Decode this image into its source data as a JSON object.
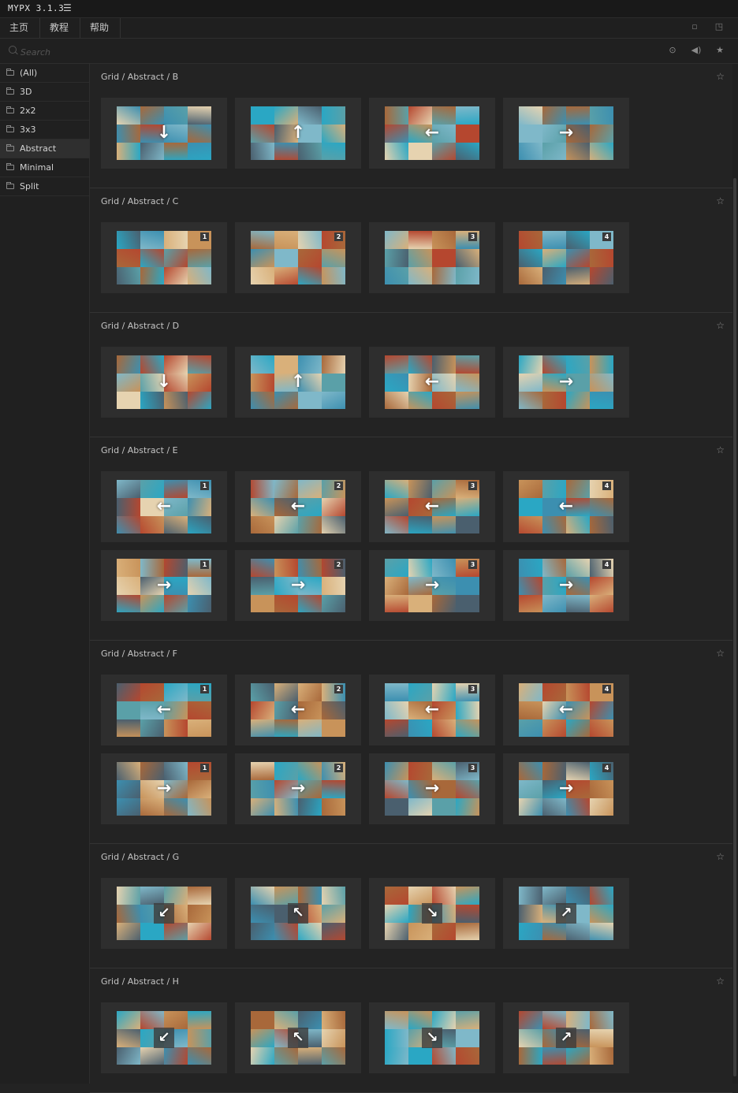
{
  "app": {
    "title": "MYPX 3.1.3"
  },
  "menu": {
    "items": [
      "主页",
      "教程",
      "帮助"
    ]
  },
  "search": {
    "placeholder": "Search"
  },
  "sidebar": {
    "items": [
      {
        "label": "(All)",
        "active": false
      },
      {
        "label": "3D",
        "active": false
      },
      {
        "label": "2x2",
        "active": false
      },
      {
        "label": "3x3",
        "active": false
      },
      {
        "label": "Abstract",
        "active": true
      },
      {
        "label": "Minimal",
        "active": false
      },
      {
        "label": "Split",
        "active": false
      }
    ]
  },
  "icons": {
    "menu": "hamburger-icon",
    "search": "search-icon",
    "play": "play-icon",
    "sound": "speaker-icon",
    "favorite": "star-icon",
    "folder": "folder-icon",
    "restore": "restore-window-icon",
    "popout": "popout-icon"
  },
  "colors": {
    "background": "#232323",
    "card": "#2e2e2e",
    "sidebar_active": "#2f2f2f",
    "tile_palette": [
      "#2aa7c4",
      "#3c8fb0",
      "#c8935a",
      "#a8683a",
      "#d9b07a",
      "#7fb8c9",
      "#4a5f6e",
      "#b5472f",
      "#e6d3b0",
      "#5aa0a8"
    ]
  },
  "sections": [
    {
      "title": "Grid / Abstract / B",
      "rows": [
        [
          {
            "arrow": "↓"
          },
          {
            "arrow": "↑"
          },
          {
            "arrow": "←"
          },
          {
            "arrow": "→"
          }
        ]
      ]
    },
    {
      "title": "Grid / Abstract / C",
      "rows": [
        [
          {
            "badge": "1"
          },
          {
            "badge": "2"
          },
          {
            "badge": "3"
          },
          {
            "badge": "4"
          }
        ]
      ]
    },
    {
      "title": "Grid / Abstract / D",
      "rows": [
        [
          {
            "arrow": "↓"
          },
          {
            "arrow": "↑"
          },
          {
            "arrow": "←"
          },
          {
            "arrow": "→"
          }
        ]
      ]
    },
    {
      "title": "Grid / Abstract / E",
      "rows": [
        [
          {
            "arrow": "←",
            "badge": "1"
          },
          {
            "arrow": "←",
            "badge": "2"
          },
          {
            "arrow": "←",
            "badge": "3"
          },
          {
            "arrow": "←",
            "badge": "4"
          }
        ],
        [
          {
            "arrow": "→",
            "badge": "1"
          },
          {
            "arrow": "→",
            "badge": "2"
          },
          {
            "arrow": "→",
            "badge": "3"
          },
          {
            "arrow": "→",
            "badge": "4"
          }
        ]
      ]
    },
    {
      "title": "Grid / Abstract / F",
      "rows": [
        [
          {
            "arrow": "←",
            "badge": "1"
          },
          {
            "arrow": "←",
            "badge": "2"
          },
          {
            "arrow": "←",
            "badge": "3"
          },
          {
            "arrow": "←",
            "badge": "4"
          }
        ],
        [
          {
            "arrow": "→",
            "badge": "1"
          },
          {
            "arrow": "→",
            "badge": "2"
          },
          {
            "arrow": "→",
            "badge": "3"
          },
          {
            "arrow": "→",
            "badge": "4"
          }
        ]
      ]
    },
    {
      "title": "Grid / Abstract / G",
      "rows": [
        [
          {
            "arrow": "↙",
            "boxed": true
          },
          {
            "arrow": "↖",
            "boxed": true
          },
          {
            "arrow": "↘",
            "boxed": true
          },
          {
            "arrow": "↗",
            "boxed": true
          }
        ]
      ]
    },
    {
      "title": "Grid / Abstract / H",
      "rows": [
        [
          {
            "arrow": "↙",
            "boxed": true
          },
          {
            "arrow": "↖",
            "boxed": true
          },
          {
            "arrow": "↘",
            "boxed": true
          },
          {
            "arrow": "↗",
            "boxed": true
          }
        ]
      ]
    }
  ]
}
